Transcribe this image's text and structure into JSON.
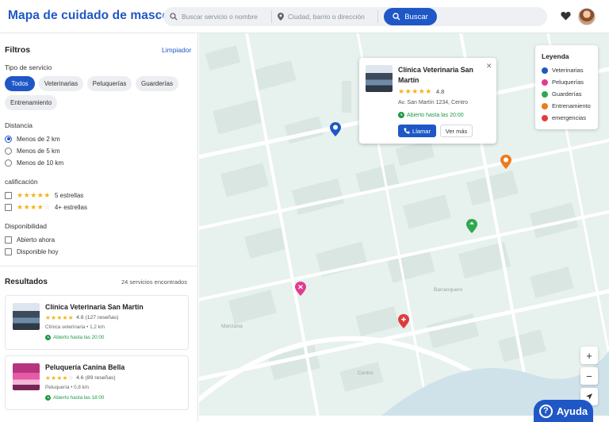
{
  "header": {
    "title": "Mapa de cuidado de mascotas",
    "service_placeholder": "Buscar servicio o nombre",
    "location_placeholder": "Ciudad, barrio o dirección",
    "search_label": "Buscar"
  },
  "filters": {
    "title": "Filtros",
    "clear_label": "Limpiador",
    "service_type_label": "Tipo de servicio",
    "chips": [
      "Todos",
      "Veterinarias",
      "Peluquerías",
      "Guarderías",
      "Entrenamiento"
    ],
    "distance_label": "Distancia",
    "distance_options": [
      "Menos de 2 km",
      "Menos de 5 km",
      "Menos de 10 km"
    ],
    "distance_selected": "Menos de 2 km",
    "rating_label": "calificación",
    "rating_options": [
      "5 estrellas",
      "4+ estrellas"
    ],
    "availability_label": "Disponibilidad",
    "availability_options": [
      "Abierto ahora",
      "Disponible hoy"
    ]
  },
  "results": {
    "title": "Resultados",
    "count": "24 servicios encontrados",
    "items": [
      {
        "name": "Clínica Veterinaria San Martín",
        "rating": "4.8",
        "reviews": "(127 reseñas)",
        "meta": "Clínica veterinaria • 1,2 km",
        "status": "Abierto hasta las 20:00"
      },
      {
        "name": "Peluquería Canina Bella",
        "rating": "4.6",
        "reviews": "(89 reseñas)",
        "meta": "Peluquería • 0,8 km",
        "status": "Abierto hasta las 18:00"
      }
    ]
  },
  "popup": {
    "name": "Clínica Veterinaria San Martín",
    "rating": "4.8",
    "address": "Av. San Martín 1234, Centro",
    "status": "Abierto hasta las 20:00",
    "call_label": "Llamar",
    "more_label": "Ver más"
  },
  "legend": {
    "title": "Leyenda",
    "items": [
      {
        "label": "Veterinarias",
        "color": "#1f57c6"
      },
      {
        "label": "Peluquerías",
        "color": "#e03c8f"
      },
      {
        "label": "Guarderías",
        "color": "#2fa84f"
      },
      {
        "label": "Entrenamiento",
        "color": "#ef7a1a"
      },
      {
        "label": "emergencias",
        "color": "#e03b3b"
      }
    ]
  },
  "map": {
    "labels": [
      "Barranquero",
      "Manzana",
      "Centro"
    ]
  },
  "help_label": "Ayuda"
}
